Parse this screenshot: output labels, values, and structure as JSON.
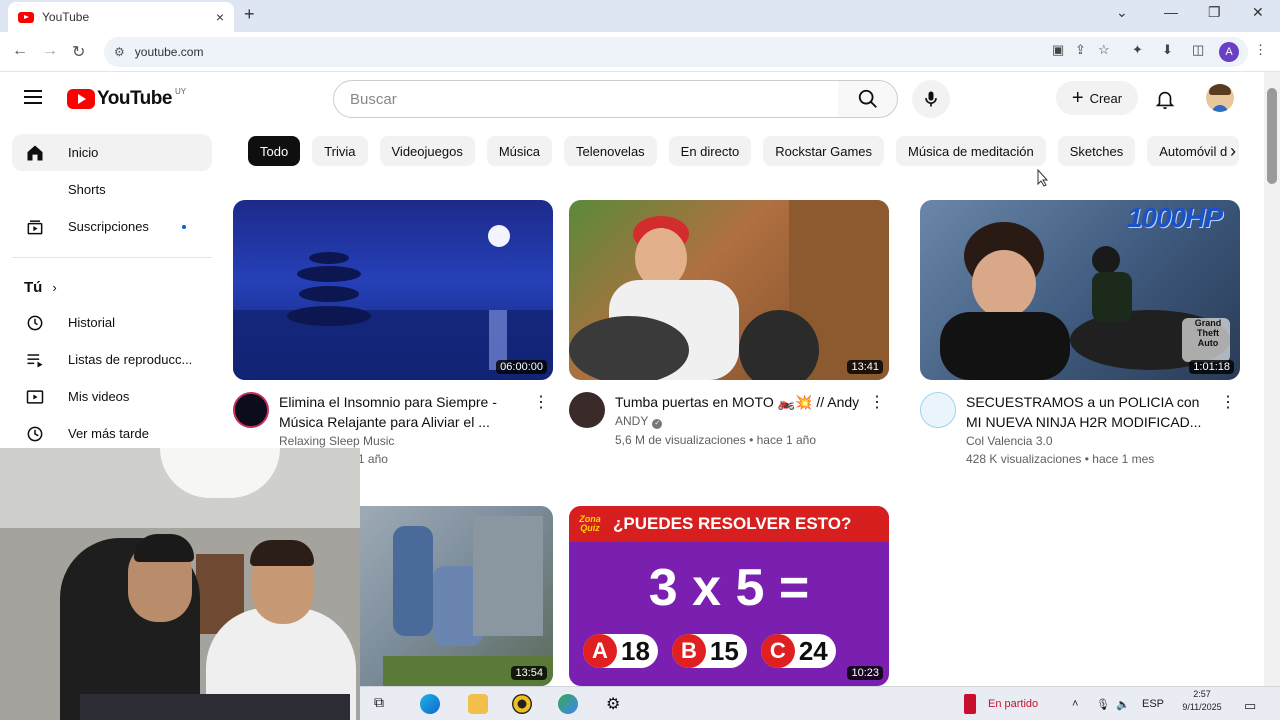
{
  "browser": {
    "tab_title": "YouTube",
    "address": "youtube.com",
    "profile_initial": "A",
    "tab_close": "×",
    "new_tab": "+"
  },
  "header": {
    "logo_text": "YouTube",
    "logo_region": "UY",
    "search_placeholder": "Buscar",
    "create_label": "Crear"
  },
  "sidebar": {
    "items": [
      {
        "label": "Inicio",
        "icon": "home-icon"
      },
      {
        "label": "Shorts",
        "icon": "shorts-icon"
      },
      {
        "label": "Suscripciones",
        "icon": "subscriptions-icon"
      }
    ],
    "you_label": "Tú",
    "you_items": [
      {
        "label": "Historial",
        "icon": "history-icon"
      },
      {
        "label": "Listas de reproducc...",
        "icon": "playlist-icon"
      },
      {
        "label": "Mis videos",
        "icon": "your-videos-icon"
      },
      {
        "label": "Ver más tarde",
        "icon": "watch-later-icon"
      }
    ]
  },
  "chips": [
    "Todo",
    "Trivia",
    "Videojuegos",
    "Música",
    "Telenovelas",
    "En directo",
    "Rockstar Games",
    "Música de meditación",
    "Sketches",
    "Automóvil d"
  ],
  "videos": [
    {
      "title": "Elimina el Insomnio para Siempre - Música Relajante para Aliviar el ...",
      "channel": "Relaxing Sleep Music",
      "stats": "...iones • hace 1 año",
      "duration": "06:00:00",
      "channel_color": "#7a1b3f",
      "verified": false
    },
    {
      "title": "Tumba puertas en MOTO 🏍️💥 // Andy",
      "channel": "ANDY",
      "stats": "5,6 M de visualizaciones • hace 1 año",
      "duration": "13:41",
      "channel_color": "#b33a3a",
      "verified": true
    },
    {
      "title": "SECUESTRAMOS a un POLICIA con MI NUEVA NINJA H2R MODIFICAD...",
      "channel": "Col Valencia 3.0",
      "stats": "428 K visualizaciones • hace 1 mes",
      "duration": "1:01:18",
      "channel_color": "#3aa0d6",
      "verified": false
    },
    {
      "duration": "13:54"
    },
    {
      "duration": "10:23",
      "thumb_logo": "Zona Quiz",
      "thumb_question": "¿PUEDES RESOLVER ESTO?",
      "thumb_equation": "3 x 5 =",
      "thumb_options": [
        {
          "letter": "A",
          "value": "18"
        },
        {
          "letter": "B",
          "value": "15"
        },
        {
          "letter": "C",
          "value": "24"
        }
      ]
    }
  ],
  "thumb_texts": {
    "hp_badge": "1000HP",
    "gta_logo": "Grand Theft Auto"
  },
  "taskbar": {
    "live_label": "En partido",
    "lang": "ESP",
    "time": "2:57",
    "date": "9/11/2025"
  },
  "colors": {
    "brand_red": "#ff0000",
    "chip_active": "#0f0f0f"
  }
}
